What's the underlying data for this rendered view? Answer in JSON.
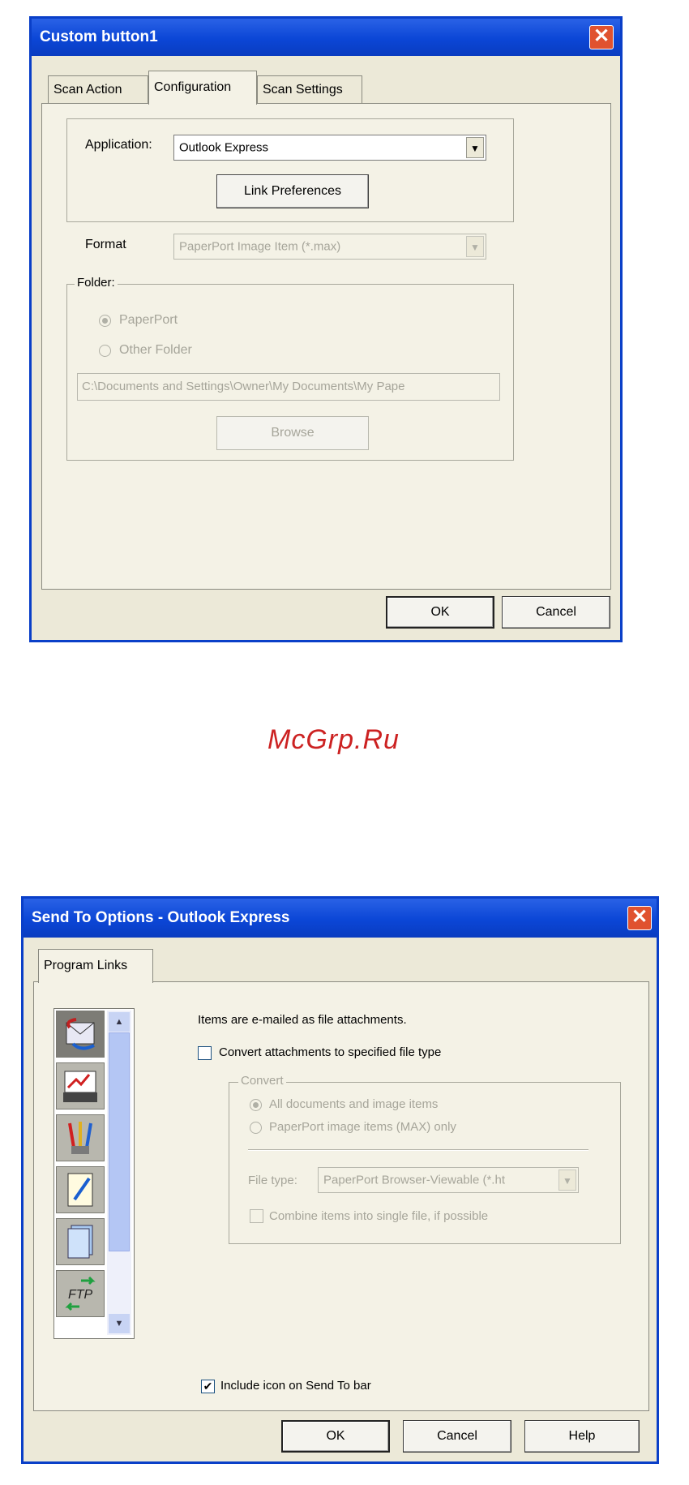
{
  "dialog1": {
    "title": "Custom button1",
    "close_symbol": "✕",
    "tabs": [
      "Scan Action",
      "Configuration",
      "Scan Settings"
    ],
    "active_tab": "Configuration",
    "application_label": "Application:",
    "application_value": "Outlook Express",
    "link_preferences_label": "Link Preferences",
    "format_label": "Format",
    "format_value": "PaperPort Image Item (*.max)",
    "folder_label": "Folder:",
    "radio_paperport": "PaperPort",
    "radio_other": "Other Folder",
    "folder_path": "C:\\Documents and Settings\\Owner\\My Documents\\My Pape",
    "browse_label": "Browse",
    "ok_label": "OK",
    "cancel_label": "Cancel"
  },
  "watermark": "McGrp.Ru",
  "dialog2": {
    "title": "Send To Options - Outlook Express",
    "close_symbol": "✕",
    "tab": "Program Links",
    "info_text": "Items are e-mailed as file attachments.",
    "convert_checkbox_label": "Convert attachments to specified file type",
    "convert_checked": false,
    "convert_group_label": "Convert",
    "radio_all": "All documents and image items",
    "radio_max": "PaperPort image items (MAX) only",
    "file_type_label": "File type:",
    "file_type_value": "PaperPort Browser-Viewable (*.ht",
    "combine_label": "Combine items into single file, if possible",
    "include_icon_label": "Include icon on Send To bar",
    "include_checked": true,
    "check_symbol": "✔",
    "ok_label": "OK",
    "cancel_label": "Cancel",
    "help_label": "Help",
    "icons": [
      "email-icon",
      "fax-icon",
      "paint-icon",
      "notepad-icon",
      "document-icon",
      "ftp-icon"
    ],
    "ftp_text": "FTP",
    "scroll_up": "▲",
    "scroll_down": "▼",
    "combo_arrow": "▼"
  }
}
